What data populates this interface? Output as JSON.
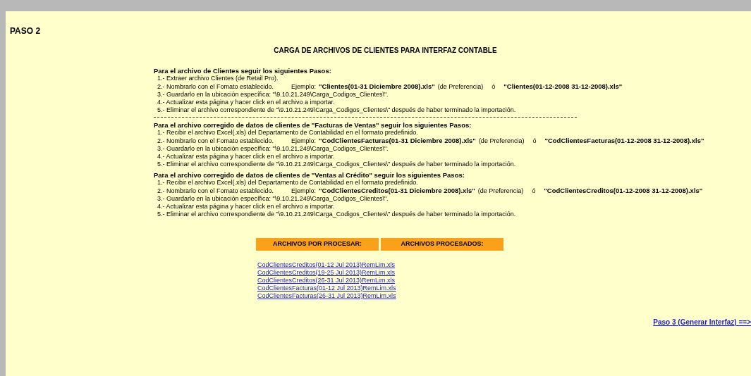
{
  "step_title": "PASO 2",
  "page_title": "CARGA DE ARCHIVOS DE CLIENTES PARA INTERFAZ CONTABLE",
  "sections": [
    {
      "kind": "instructions",
      "heading": "Para el archivo de Clientes seguir los siguientes Pasos:",
      "steps": [
        {
          "text": "1.- Extraer archivo Clientes (de Retail Pro)."
        },
        {
          "text": "2.- Nombrarlo con el Fomato establecido.",
          "example_label": "Ejemplo:",
          "example": "\"Clientes(01-31 Diciembre 2008).xls\"",
          "note": "(de Preferencia)",
          "or": "ó",
          "alt": "\"Clientes(01-12-2008 31-12-2008).xls\""
        },
        {
          "text": "3.- Guardarlo en la ubicación específica: \"\\9.10.21.249\\Carga_Codigos_Clientes\\\"."
        },
        {
          "text": "4.- Actualizar esta página y hacer click en el archivo a importar."
        },
        {
          "text": "5.- Eliminar el archivo correspondiente de \"\\9.10.21.249\\Carga_Codigos_Clientes\\\" después de haber terminado la importación."
        }
      ]
    },
    {
      "kind": "separator"
    },
    {
      "kind": "instructions",
      "heading": "Para el archivo corregido de datos de clientes de \"Facturas de Ventas\" seguir los siguientes Pasos:",
      "steps": [
        {
          "text": "1.- Recibir el archivo Excel(.xls) del Departamento de Contabilidad en el formato predefinido."
        },
        {
          "text": "2.- Nombrarlo con el Fomato establecido.",
          "example_label": "Ejemplo:",
          "example": "\"CodClientesFacturas(01-31 Diciembre 2008).xls\"",
          "note": "(de Preferencia)",
          "or": "ó",
          "alt": "\"CodClientesFacturas(01-12-2008 31-12-2008).xls\""
        },
        {
          "text": "3.- Guardarlo en la ubicación específica: \"\\9.10.21.249\\Carga_Codigos_Clientes\\\"."
        },
        {
          "text": "4.- Actualizar esta página y hacer click en el archivo a importar."
        },
        {
          "text": "5.- Eliminar el archivo correspondiente de \"\\9.10.21.249\\Carga_Codigos_Clientes\\\" después de haber terminado la importación."
        }
      ]
    },
    {
      "kind": "instructions",
      "heading": "Para el archivo corregido de datos de clientes de \"Ventas al Crédito\" seguir los siguientes Pasos:",
      "steps": [
        {
          "text": "1.- Recibir el archivo Excel(.xls) del Departamento de Contabilidad en el formato predefinido."
        },
        {
          "text": "2.- Nombrarlo con el Fomato establecido.",
          "example_label": "Ejemplo:",
          "example": "\"CodClientesCreditos(01-31 Diciembre 2008).xls\"",
          "note": "(de Preferencia)",
          "or": "ó",
          "alt": "\"CodClientesCreditos(01-12-2008 31-12-2008).xls\""
        },
        {
          "text": "3.- Guardarlo en la ubicación específica: \"\\9.10.21.249\\Carga_Codigos_Clientes\\\"."
        },
        {
          "text": "4.- Actualizar esta página y hacer click en el archivo a importar."
        },
        {
          "text": "5.- Eliminar el archivo correspondiente de \"\\9.10.21.249\\Carga_Codigos_Clientes\\\" después de haber terminado la importación."
        }
      ]
    }
  ],
  "table": {
    "columns": [
      "ARCHIVOS POR PROCESAR:",
      "ARCHIVOS PROCESADOS:"
    ],
    "pending_files": [
      "CodClientesCreditos(01-12 Jul 2013)RemLim.xls",
      "CodClientesCreditos(19-25 Jul 2013)RemLim.xls",
      "CodClientesCreditos(26-31 Jul 2013)RemLim.xls",
      "CodClientesFacturas(01-12 Jul 2013)RemLim.xls",
      "CodClientesFacturas(26-31 Jul 2013)RemLim.xls"
    ]
  },
  "next_link": "Paso 3 (Generar Interfaz) ==>"
}
